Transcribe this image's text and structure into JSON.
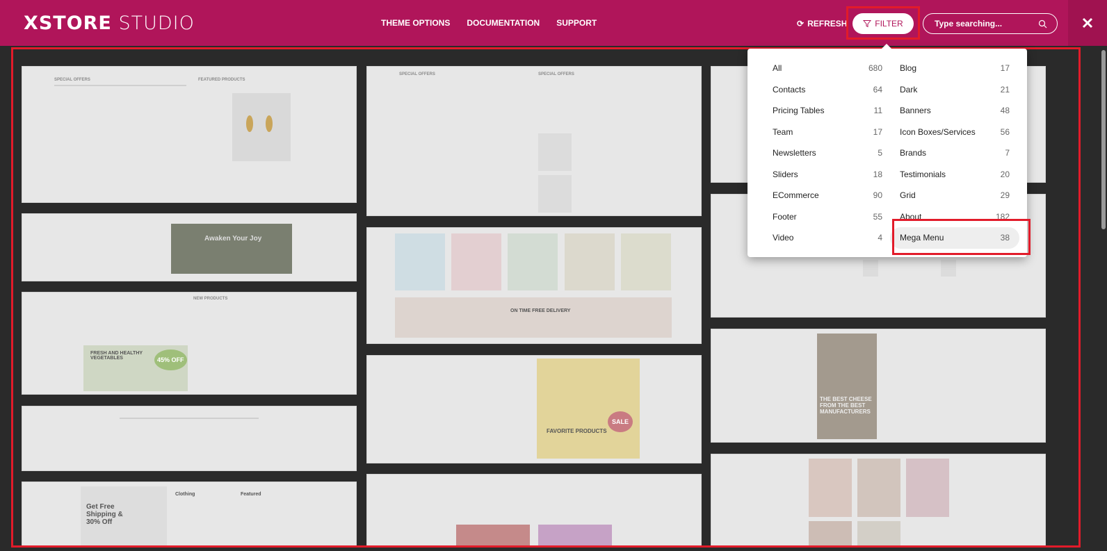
{
  "brand": {
    "logo_bold": "XSTORE",
    "logo_light": "STUDIO",
    "accent": "#b0155a"
  },
  "nav": [
    "THEME OPTIONS",
    "DOCUMENTATION",
    "SUPPORT"
  ],
  "toolbar": {
    "refresh_label": "REFRESH",
    "filter_label": "FILTER",
    "search_placeholder": "Type searching...",
    "refresh_icon": "refresh-icon",
    "filter_icon": "funnel-icon",
    "search_icon": "search-icon",
    "close_icon": "close-icon"
  },
  "filter": {
    "left": [
      {
        "label": "All",
        "count": "680"
      },
      {
        "label": "Contacts",
        "count": "64"
      },
      {
        "label": "Pricing Tables",
        "count": "11"
      },
      {
        "label": "Team",
        "count": "17"
      },
      {
        "label": "Newsletters",
        "count": "5"
      },
      {
        "label": "Sliders",
        "count": "18"
      },
      {
        "label": "ECommerce",
        "count": "90"
      },
      {
        "label": "Footer",
        "count": "55"
      },
      {
        "label": "Video",
        "count": "4"
      }
    ],
    "right": [
      {
        "label": "Blog",
        "count": "17"
      },
      {
        "label": "Dark",
        "count": "21"
      },
      {
        "label": "Banners",
        "count": "48"
      },
      {
        "label": "Icon Boxes/Services",
        "count": "56"
      },
      {
        "label": "Brands",
        "count": "7"
      },
      {
        "label": "Testimonials",
        "count": "20"
      },
      {
        "label": "Grid",
        "count": "29"
      },
      {
        "label": "About",
        "count": "182"
      },
      {
        "label": "Mega Menu",
        "count": "38"
      }
    ]
  },
  "previews": {
    "awaken": "Awaken Your Joy",
    "fresh": "FRESH AND HEALTHY VEGETABLES",
    "discount": "45% OFF",
    "delivery": "ON TIME FREE DELIVERY",
    "favorite": "FAVORITE PRODUCTS",
    "sale": "SALE",
    "shipping": "Get Free Shipping & 30% Off",
    "best": "THE BEST CHEESE FROM THE BEST MANUFACTURERS",
    "clothing": "Clothing",
    "featured": "Featured",
    "new_products": "NEW PRODUCTS",
    "special_offers": "SPECIAL OFFERS",
    "featured_products": "FEATURED PRODUCTS"
  }
}
